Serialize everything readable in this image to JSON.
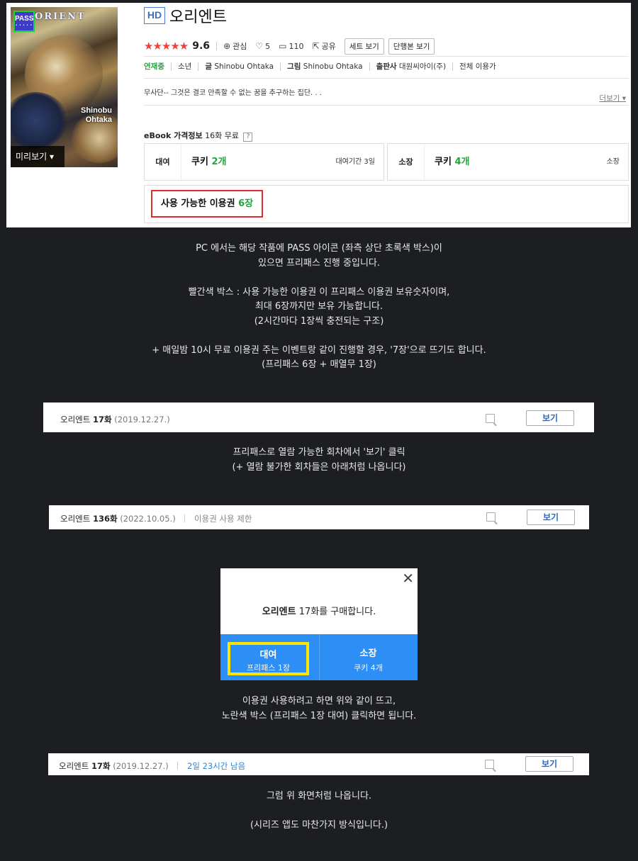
{
  "cover": {
    "pass_badge": "PASS",
    "pass_dots": "• • • • •",
    "title_art": "ORIENT",
    "author_art": "Shinobu Ohtaka",
    "preview_label": "미리보기 ▾"
  },
  "detail": {
    "hd_badge": "HD",
    "title": "오리엔트",
    "stars": "★★★★★",
    "score": "9.6",
    "interest_label": "관심",
    "likes": "5",
    "comments": "110",
    "share_label": "공유",
    "set_view_label": "세트 보기",
    "volume_view_label": "단행본 보기",
    "status": "연재중",
    "genre": "소년",
    "writer_label": "글",
    "writer": "Shinobu Ohtaka",
    "artist_label": "그림",
    "artist": "Shinobu Ohtaka",
    "publisher_label": "출판사",
    "publisher": "대원씨아이(주)",
    "age": "전체 이용가",
    "description": "무사단-- 그것은 결코 만족할 수 없는 꿈을 추구하는 집단. . .",
    "more_label": "더보기 ▾",
    "price_title": "eBook 가격정보",
    "price_free": "16화 무료",
    "price_help": "?",
    "rent_label": "대여",
    "rent_value_prefix": "쿠키 ",
    "rent_value_num": "2개",
    "rent_note": "대여기간 3일",
    "own_label": "소장",
    "own_value_prefix": "쿠키 ",
    "own_value_num": "4개",
    "own_note": "소장",
    "ticket_prefix": "사용 가능한 이용권 ",
    "ticket_num": "6장"
  },
  "captions": {
    "c1_l1": "PC 에서는 해당 작품에 PASS 아이콘 (좌측 상단 초록색 박스)이",
    "c1_l2": "있으면 프리패스 진행 중입니다.",
    "c1_l3": "빨간색 박스 : 사용 가능한 이용권 이 프리패스 이용권 보유숫자이며,",
    "c1_l4": "최대 6장까지만 보유 가능합니다.",
    "c1_l5": "(2시간마다 1장씩 충전되는 구조)",
    "c1_l6": "+ 매일밤 10시 무료 이용권 주는 이벤트랑 같이 진행할 경우, '7장'으로 뜨기도 합니다.",
    "c1_l7": "(프리패스 6장 + 매열무 1장)",
    "c2_l1": "프리패스로 열람 가능한 회차에서 '보기' 클릭",
    "c2_l2": "(+ 열람 불가한 회차들은 아래처럼 나옵니다)",
    "c3_l1": "이용권 사용하려고 하면 위와 같이 뜨고,",
    "c3_l2": "노란색 박스 (프리패스 1장 대여) 클릭하면 됩니다.",
    "c4_l1": "그럼 위 화면처럼 나옵니다.",
    "c4_l2": "(시리즈 앱도 마찬가지 방식입니다.)"
  },
  "episodes": [
    {
      "name": "오리엔트 ",
      "num": "17화",
      "date": "(2019.12.27.)",
      "extra": "",
      "view": "보기"
    },
    {
      "name": "오리엔트 ",
      "num": "136화",
      "date": "(2022.10.05.)",
      "extra": "이용권 사용 제한",
      "view": "보기"
    },
    {
      "name": "오리엔트 ",
      "num": "17화",
      "date": "(2019.12.27.)",
      "extra": "2일 23시간 남음",
      "view": "보기"
    }
  ],
  "modal": {
    "close": "✕",
    "msg_title": "오리엔트",
    "msg_rest": " 17화를 구매합니다.",
    "rent_title": "대여",
    "rent_sub": "프리패스 1장",
    "own_title": "소장",
    "own_sub": "쿠키 4개"
  },
  "colors": {
    "background": "#1c1e21",
    "green_accent": "#1fa53c",
    "red_box": "#e22b2b",
    "yellow_box": "#ffe400",
    "modal_blue": "#2d8ef5",
    "link_blue": "#2f86d0"
  }
}
